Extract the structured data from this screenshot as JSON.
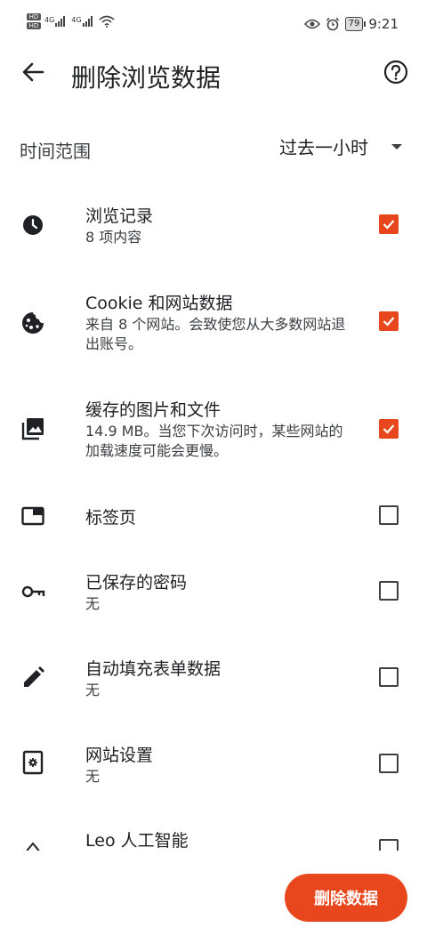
{
  "status_bar": {
    "hd1": "HD",
    "hd2": "HD",
    "net1": "4G",
    "net2": "4G",
    "battery": "79",
    "time": "9:21"
  },
  "header": {
    "title": "删除浏览数据"
  },
  "time_range": {
    "label": "时间范围",
    "value": "过去一小时"
  },
  "items": [
    {
      "title": "浏览记录",
      "desc": "8 项内容",
      "checked": true,
      "icon": "clock-icon"
    },
    {
      "title": "Cookie 和网站数据",
      "desc": "来自 8 个网站。会致使您从大多数网站退出账号。",
      "checked": true,
      "icon": "cookie-icon"
    },
    {
      "title": "缓存的图片和文件",
      "desc": "14.9 MB。当您下次访问时，某些网站的加载速度可能会更慢。",
      "checked": true,
      "icon": "image-icon"
    },
    {
      "title": "标签页",
      "desc": "",
      "checked": false,
      "icon": "tab-icon"
    },
    {
      "title": "已保存的密码",
      "desc": "无",
      "checked": false,
      "icon": "key-icon"
    },
    {
      "title": "自动填充表单数据",
      "desc": "无",
      "checked": false,
      "icon": "pencil-icon"
    },
    {
      "title": "网站设置",
      "desc": "无",
      "checked": false,
      "icon": "site-settings-icon"
    },
    {
      "title": "Leo 人工智能",
      "desc": "",
      "checked": false,
      "icon": "leo-icon"
    }
  ],
  "action": {
    "delete_label": "删除数据"
  },
  "colors": {
    "accent": "#e8461c",
    "text": "#202124"
  }
}
